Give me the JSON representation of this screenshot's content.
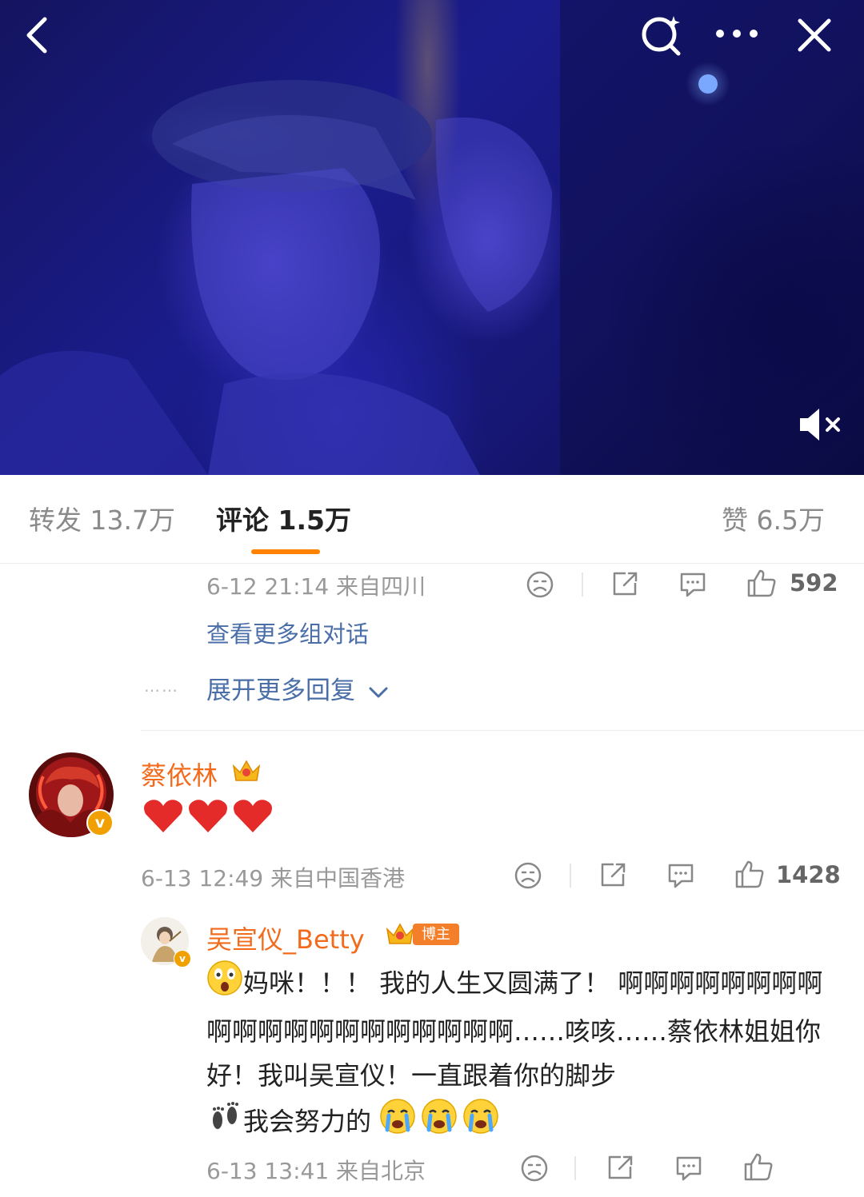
{
  "video": {
    "back_icon": "chevron-left-icon",
    "search_icon": "search-sparkle-icon",
    "more_icon": "more-dots-icon",
    "close_icon": "close-icon",
    "mute_icon": "speaker-muted-icon"
  },
  "tabs": {
    "repost": "转发 13.7万",
    "comments": "评论 1.5万",
    "likes": "赞 6.5万"
  },
  "colors": {
    "accent": "#ff8200",
    "username": "#f26b1d",
    "link": "#4a6ea8",
    "meta": "#999999"
  },
  "comment1": {
    "meta": "6-12 21:14 来自四川",
    "like_count": "592",
    "view_more_threads": "查看更多组对话",
    "expand_more_replies": "展开更多回复",
    "dots": "……"
  },
  "comment2": {
    "username": "蔡依林",
    "content": "❤️❤️❤️",
    "meta": "6-13 12:49 来自中国香港",
    "like_count": "1428",
    "avatar_badge": "v"
  },
  "reply": {
    "username": "吴宣仪_Betty",
    "badge_label": "博主",
    "text_lead_emoji": "😲",
    "text": "妈咪！！！ 我的人生又圆满了！ 啊啊啊啊啊啊啊啊啊啊啊啊啊啊啊啊啊啊啊啊……咳咳……蔡依林姐姐你好！我叫吴宣仪！一直跟着你的脚步",
    "text_footprints": "👣",
    "text_tail": "我会努力的",
    "text_tail_emoji": "😭😭😭",
    "meta": "6-13 13:41 来自北京"
  }
}
